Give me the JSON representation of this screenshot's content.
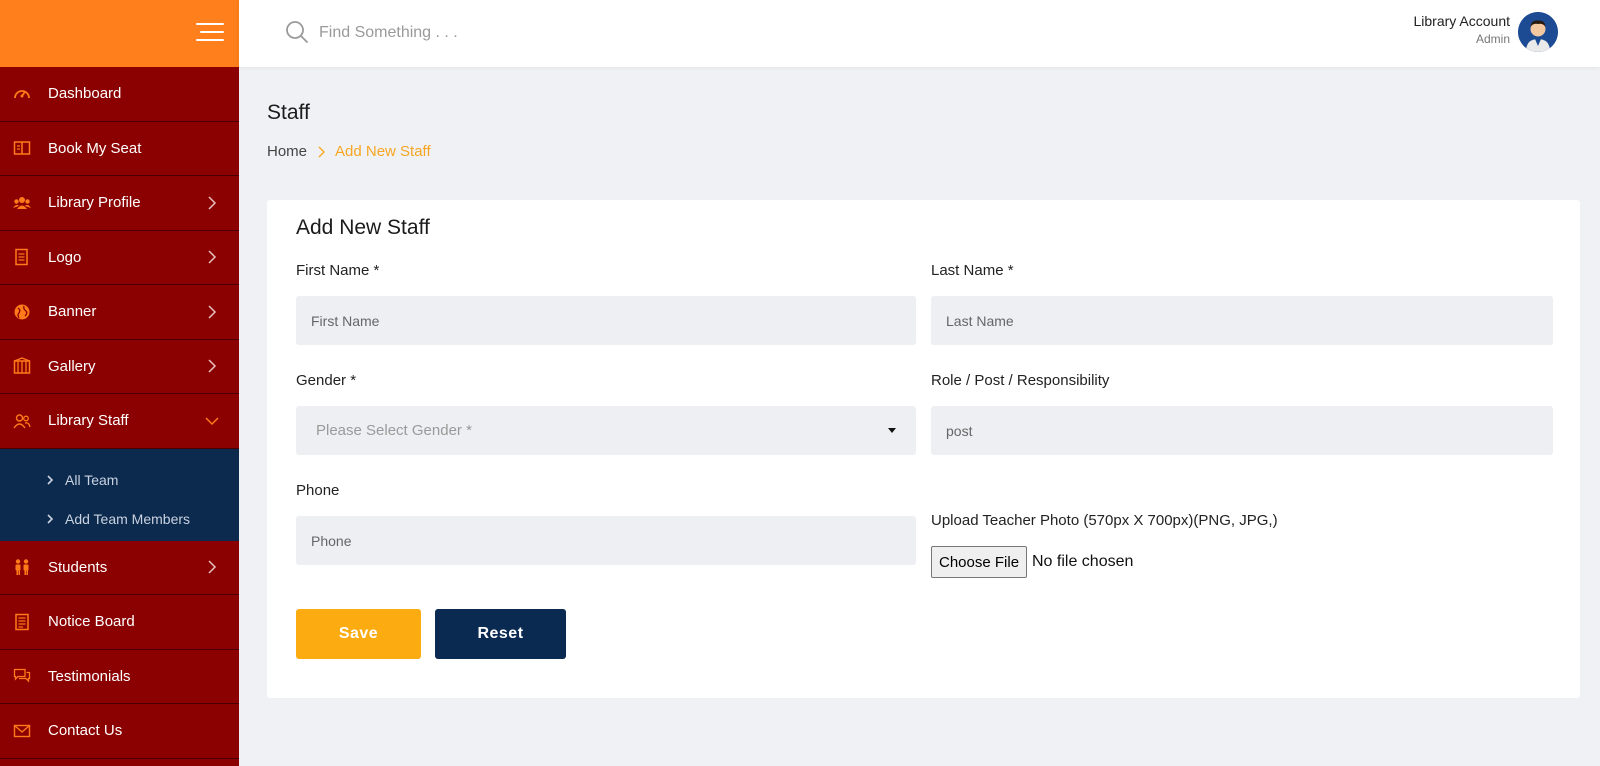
{
  "sidebar": {
    "items": [
      {
        "label": "Dashboard",
        "icon": "gauge-icon",
        "has_arrow": false
      },
      {
        "label": "Book My Seat",
        "icon": "book-icon",
        "has_arrow": false
      },
      {
        "label": "Library Profile",
        "icon": "users-icon",
        "has_arrow": true
      },
      {
        "label": "Logo",
        "icon": "document-icon",
        "has_arrow": true
      },
      {
        "label": "Banner",
        "icon": "globe-icon",
        "has_arrow": true
      },
      {
        "label": "Gallery",
        "icon": "building-icon",
        "has_arrow": true
      },
      {
        "label": "Library Staff",
        "icon": "staff-icon",
        "has_arrow": true,
        "expanded": true
      },
      {
        "label": "Students",
        "icon": "students-icon",
        "has_arrow": true
      },
      {
        "label": "Notice Board",
        "icon": "notice-icon",
        "has_arrow": false
      },
      {
        "label": "Testimonials",
        "icon": "chat-icon",
        "has_arrow": false
      },
      {
        "label": "Contact Us",
        "icon": "mail-icon",
        "has_arrow": false
      }
    ],
    "submenu": [
      {
        "label": "All Team"
      },
      {
        "label": "Add Team Members"
      }
    ]
  },
  "topbar": {
    "search_placeholder": "Find Something . . .",
    "account_name": "Library Account",
    "account_role": "Admin"
  },
  "page": {
    "title": "Staff",
    "breadcrumb_home": "Home",
    "breadcrumb_current": "Add New Staff"
  },
  "form": {
    "title": "Add New Staff",
    "first_name_label": "First Name *",
    "first_name_placeholder": "First Name",
    "last_name_label": "Last Name *",
    "last_name_placeholder": "Last Name",
    "gender_label": "Gender *",
    "gender_placeholder": "Please Select Gender *",
    "role_label": "Role / Post / Responsibility",
    "role_placeholder": "post",
    "phone_label": "Phone",
    "phone_placeholder": "Phone",
    "upload_label": "Upload Teacher Photo (570px X 700px)(PNG, JPG,)",
    "choose_file": "Choose File",
    "file_status": "No file chosen",
    "save_label": "Save",
    "reset_label": "Reset"
  },
  "colors": {
    "sidebar_bg": "#8b0000",
    "sidebar_top": "#fe7f1b",
    "submenu_bg": "#0c2a4e",
    "icon_accent": "#ff7a1a",
    "breadcrumb_active": "#f6a623",
    "save_btn": "#fcac11",
    "reset_btn": "#0b2a52"
  }
}
